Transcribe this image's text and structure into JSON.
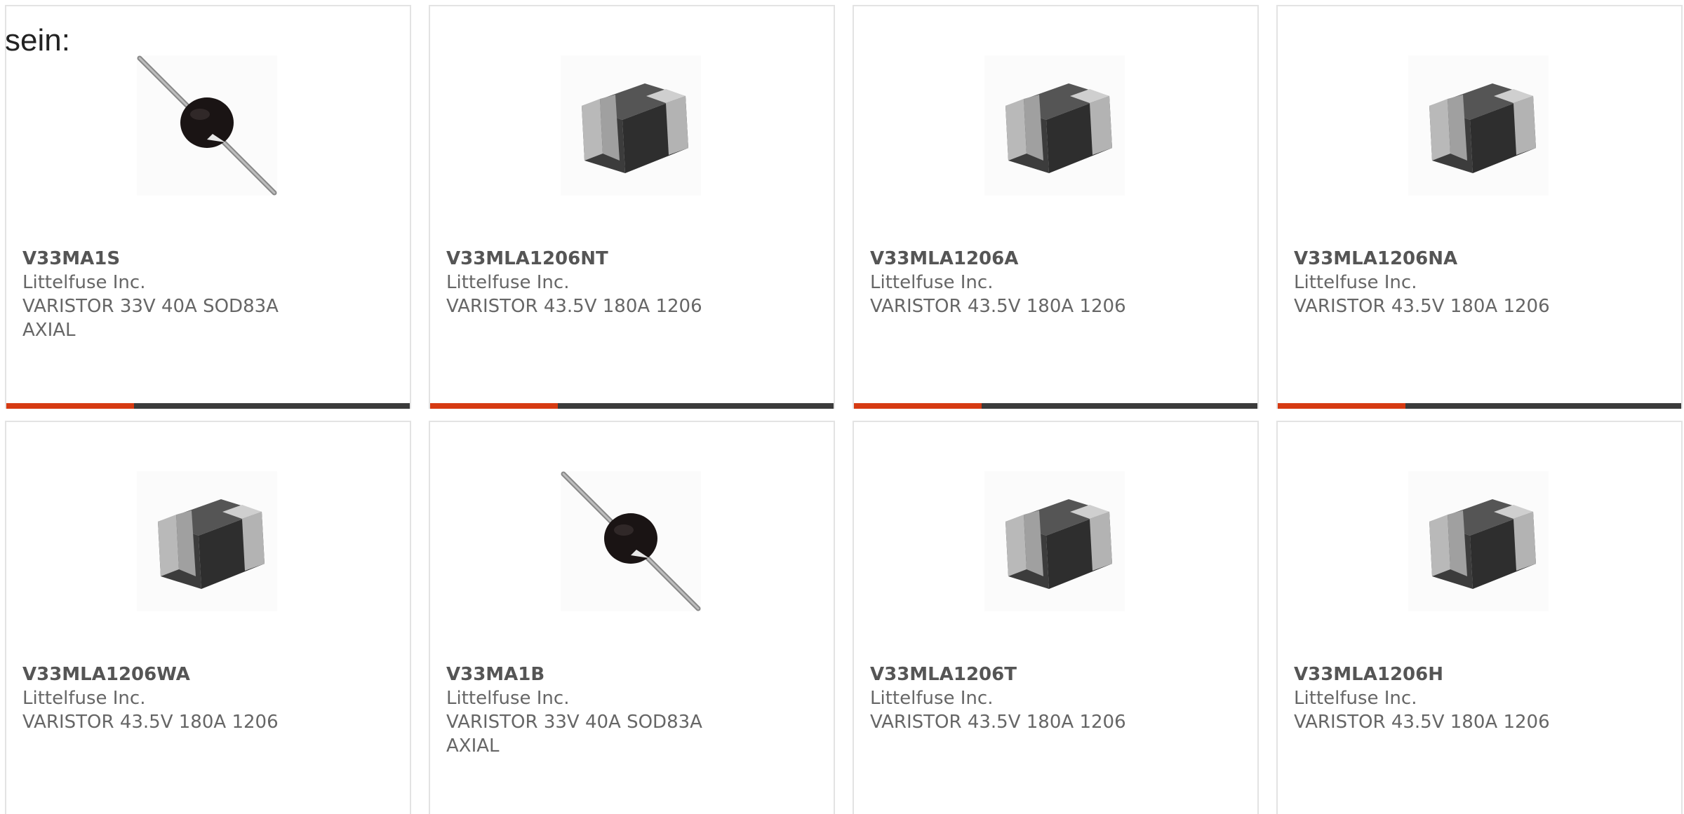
{
  "intro_text": "sein:",
  "accent_color": "#d63a12",
  "bar_color": "#3b3b3b",
  "products": [
    {
      "part": "V33MA1S",
      "manufacturer": "Littelfuse Inc.",
      "description": "VARISTOR 33V 40A SOD83A AXIAL",
      "image": "axial-varistor-icon"
    },
    {
      "part": "V33MLA1206NT",
      "manufacturer": "Littelfuse Inc.",
      "description": "VARISTOR 43.5V 180A 1206",
      "image": "smd-chip-icon"
    },
    {
      "part": "V33MLA1206A",
      "manufacturer": "Littelfuse Inc.",
      "description": "VARISTOR 43.5V 180A 1206",
      "image": "smd-chip-icon"
    },
    {
      "part": "V33MLA1206NA",
      "manufacturer": "Littelfuse Inc.",
      "description": "VARISTOR 43.5V 180A 1206",
      "image": "smd-chip-icon"
    },
    {
      "part": "V33MLA1206WA",
      "manufacturer": "Littelfuse Inc.",
      "description": "VARISTOR 43.5V 180A 1206",
      "image": "smd-chip-icon"
    },
    {
      "part": "V33MA1B",
      "manufacturer": "Littelfuse Inc.",
      "description": "VARISTOR 33V 40A SOD83A AXIAL",
      "image": "axial-varistor-icon"
    },
    {
      "part": "V33MLA1206T",
      "manufacturer": "Littelfuse Inc.",
      "description": "VARISTOR 43.5V 180A 1206",
      "image": "smd-chip-icon"
    },
    {
      "part": "V33MLA1206H",
      "manufacturer": "Littelfuse Inc.",
      "description": "VARISTOR 43.5V 180A 1206",
      "image": "smd-chip-icon"
    }
  ]
}
